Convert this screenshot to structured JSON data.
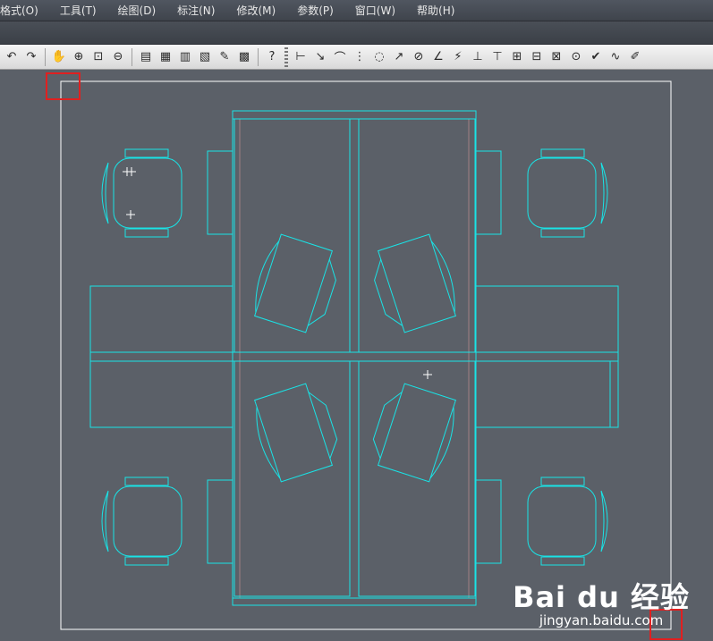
{
  "menubar": {
    "items": [
      "格式(O)",
      "工具(T)",
      "绘图(D)",
      "标注(N)",
      "修改(M)",
      "参数(P)",
      "窗口(W)",
      "帮助(H)"
    ]
  },
  "toolbar": {
    "groups": [
      [
        "undo-icon",
        "redo-icon"
      ],
      [
        "pan-icon",
        "zoom-realtime-icon",
        "zoom-window-icon",
        "zoom-previous-icon"
      ],
      [
        "properties-icon",
        "design-center-icon",
        "tool-palettes-icon",
        "sheet-set-icon",
        "markup-icon",
        "calculator-icon"
      ],
      [
        "help-icon"
      ],
      [
        "linear-dimension-icon",
        "aligned-dimension-icon",
        "arc-length-icon",
        "ordinate-dimension-icon",
        "radius-dimension-icon",
        "jogged-dimension-icon",
        "diameter-dimension-icon",
        "angular-dimension-icon",
        "quick-dimension-icon",
        "baseline-dimension-icon",
        "continue-dimension-icon",
        "dimension-space-icon",
        "dimension-break-icon",
        "tolerance-icon",
        "center-mark-icon",
        "inspect-icon",
        "jogged-linear-icon",
        "dimension-edit-icon"
      ]
    ]
  },
  "drawing": {
    "line_color": "#19e3e6",
    "frame_color": "#ffffff",
    "background": "#5b6068"
  },
  "highlight_color": "#e02020",
  "watermark": {
    "logo": "Bai du 经验",
    "url": "jingyan.baidu.com"
  }
}
